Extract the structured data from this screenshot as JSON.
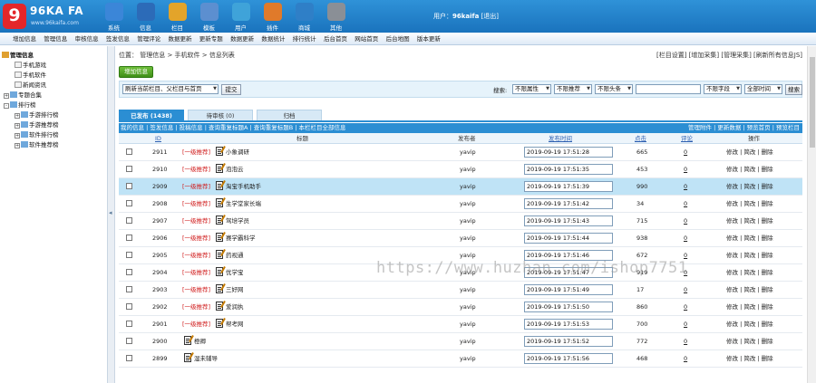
{
  "logo": {
    "badge": "9",
    "name": "96KA FA",
    "sub": "www.96kaifa.com"
  },
  "topnav": [
    {
      "label": "系统",
      "color": "#3b86d8"
    },
    {
      "label": "信息",
      "color": "#2c6bb8"
    },
    {
      "label": "栏目",
      "color": "#e3a42a"
    },
    {
      "label": "模板",
      "color": "#5c8fd0"
    },
    {
      "label": "用户",
      "color": "#3fa3d9"
    },
    {
      "label": "插件",
      "color": "#e07a2a"
    },
    {
      "label": "商城",
      "color": "#2f7fc7"
    },
    {
      "label": "其他",
      "color": "#8a8f96"
    }
  ],
  "user": {
    "label": "用户：",
    "name": "96kaifa",
    "logout": "[退出]"
  },
  "menubar": [
    "增加信息",
    "管理信息",
    "审核信息",
    "签发信息",
    "管理评论",
    "数据更新",
    "更新专题",
    "数据更新",
    "数据统计",
    "排行统计",
    "后台首页",
    "网站首页",
    "后台地图",
    "版本更新"
  ],
  "sidebar": {
    "root": "管理信息",
    "items": [
      "手机游戏",
      "手机软件",
      "新闻资讯",
      "专题合集",
      "排行榜",
      "手游排行榜",
      "手游推荐榜",
      "软件排行榜",
      "软件推荐榜"
    ]
  },
  "location": {
    "text": "位置：  管理信息 > 手机软件 > 信息列表"
  },
  "toplinks": "[栏目设置] [增加采集] [管理采集] [刷新所有信息JS]",
  "add_button": "增加信息",
  "toolbar": {
    "refresh_select": "刷新当前栏目、父栏目与首页",
    "submit": "提交",
    "search_label": "搜索:",
    "attr": "不限属性",
    "recommend": "不限推荐",
    "headline": "不限头条",
    "field": "不限字段",
    "time": "全部时间",
    "search_btn": "搜索"
  },
  "tabs": [
    {
      "label": "已发布 (1438)",
      "active": true
    },
    {
      "label": "待审核 (0)",
      "active": false
    },
    {
      "label": "归档",
      "active": false
    }
  ],
  "infobar": {
    "left": "我的信息 | 签发信息 | 投稿信息 | 查询重复标题A | 查询重复标题B | 本栏栏目全部信息",
    "right": "管理附件 | 更新数据 | 预览首页 | 预览栏目"
  },
  "columns": {
    "id": "ID",
    "title": "标题",
    "author": "发布者",
    "time": "发布时间",
    "hits": "点击",
    "comments": "评论",
    "ops": "操作"
  },
  "rows": [
    {
      "id": "2911",
      "rec": "[一级推荐]",
      "title": "小象调研",
      "author": "yavip",
      "time": "2019-09-19 17:51:28",
      "hits": "665",
      "comments": "0",
      "ops": "修改 | 简改 | 删除"
    },
    {
      "id": "2910",
      "rec": "[一级推荐]",
      "title": "泡泡云",
      "author": "yavip",
      "time": "2019-09-19 17:51:35",
      "hits": "453",
      "comments": "0",
      "ops": "修改 | 简改 | 删除"
    },
    {
      "id": "2909",
      "rec": "[一级推荐]",
      "title": "淘宝手机助手",
      "author": "yavip",
      "time": "2019-09-19 17:51:39",
      "hits": "990",
      "comments": "0",
      "ops": "修改 | 简改 | 删除"
    },
    {
      "id": "2908",
      "rec": "[一级推荐]",
      "title": "生学堂家长端",
      "author": "yavip",
      "time": "2019-09-19 17:51:42",
      "hits": "34",
      "comments": "0",
      "ops": "修改 | 简改 | 删除"
    },
    {
      "id": "2907",
      "rec": "[一级推荐]",
      "title": "驾培学员",
      "author": "yavip",
      "time": "2019-09-19 17:51:43",
      "hits": "715",
      "comments": "0",
      "ops": "修改 | 简改 | 删除"
    },
    {
      "id": "2906",
      "rec": "[一级推荐]",
      "title": "赛学霸科学",
      "author": "yavip",
      "time": "2019-09-19 17:51:44",
      "hits": "938",
      "comments": "0",
      "ops": "修改 | 简改 | 删除"
    },
    {
      "id": "2905",
      "rec": "[一级推荐]",
      "title": "药视通",
      "author": "yavip",
      "time": "2019-09-19 17:51:46",
      "hits": "672",
      "comments": "0",
      "ops": "修改 | 简改 | 删除"
    },
    {
      "id": "2904",
      "rec": "[一级推荐]",
      "title": "优学宝",
      "author": "yavip",
      "time": "2019-09-19 17:51:47",
      "hits": "919",
      "comments": "0",
      "ops": "修改 | 简改 | 删除"
    },
    {
      "id": "2903",
      "rec": "[一级推荐]",
      "title": "三好网",
      "author": "yavip",
      "time": "2019-09-19 17:51:49",
      "hits": "17",
      "comments": "0",
      "ops": "修改 | 简改 | 删除"
    },
    {
      "id": "2902",
      "rec": "[一级推荐]",
      "title": "爱润执",
      "author": "yavip",
      "time": "2019-09-19 17:51:50",
      "hits": "860",
      "comments": "0",
      "ops": "修改 | 简改 | 删除"
    },
    {
      "id": "2901",
      "rec": "[一级推荐]",
      "title": "帮考网",
      "author": "yavip",
      "time": "2019-09-19 17:51:53",
      "hits": "700",
      "comments": "0",
      "ops": "修改 | 简改 | 删除"
    },
    {
      "id": "2900",
      "rec": "",
      "title": "橙卿",
      "author": "yavip",
      "time": "2019-09-19 17:51:52",
      "hits": "772",
      "comments": "0",
      "ops": "修改 | 简改 | 删除"
    },
    {
      "id": "2899",
      "rec": "",
      "title": "湿未辅导",
      "author": "yavip",
      "time": "2019-09-19 17:51:56",
      "hits": "468",
      "comments": "0",
      "ops": "修改 | 简改 | 删除"
    }
  ],
  "highlight_row": 2,
  "watermark": "https://www.huzhan.com/ishop7751"
}
